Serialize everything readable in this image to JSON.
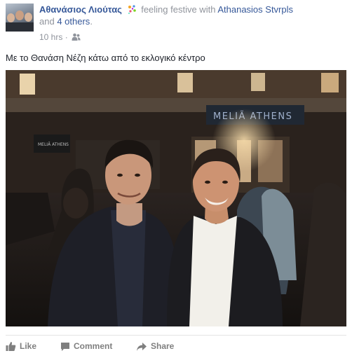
{
  "post": {
    "author": "Αθανάσιος Λιούτας",
    "feeling_text": "feeling festive with",
    "tagged_person": "Athanasios Stvrpls",
    "and_text": "and",
    "others_link": "4 others",
    "period": ".",
    "timestamp": "10 hrs",
    "separator": "·",
    "body": "Με το Θανάση Νέζη κάτω από το εκλογικό κέντρο",
    "photo_sign": "MELIÃ ATHENS",
    "photo_sign_small": "MELIÃ ATHENS"
  },
  "actions": {
    "like": "Like",
    "comment": "Comment",
    "share": "Share"
  },
  "icons": {
    "feeling": "party-popper-icon",
    "audience": "friends-icon",
    "like": "thumbs-up-icon",
    "comment": "speech-bubble-icon",
    "share": "share-arrow-icon"
  },
  "colors": {
    "link": "#365899",
    "meta": "#90949c",
    "action": "#7f7f7f",
    "sign": "#9fb0cc"
  }
}
